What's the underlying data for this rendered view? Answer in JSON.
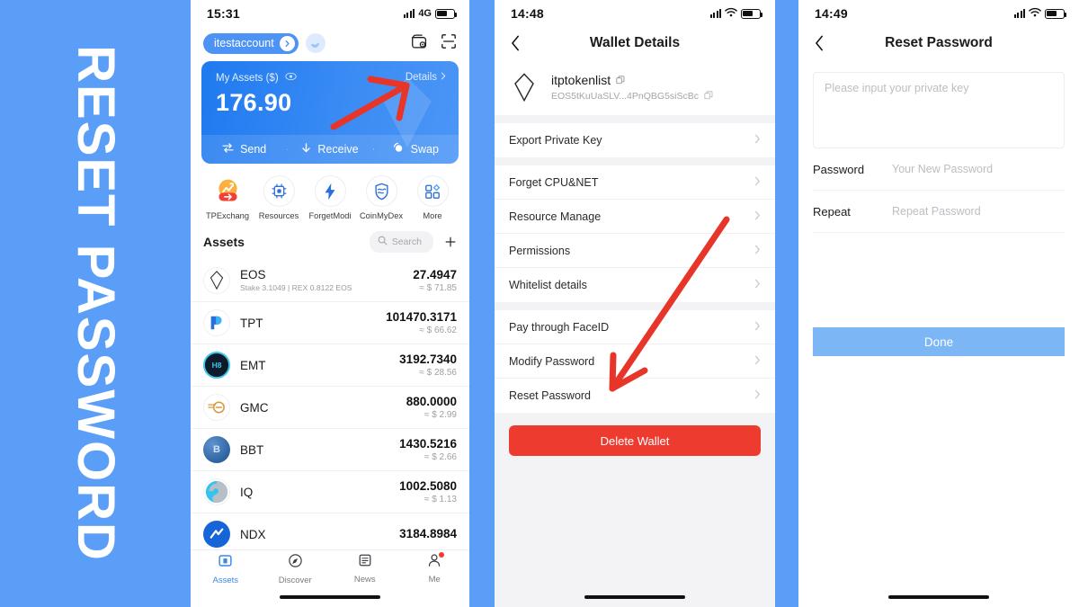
{
  "caption": {
    "text": "RESET PASSWORD"
  },
  "theme": {
    "background": "#5b9ef7",
    "accent": "#3b86f0",
    "danger": "#ee3b2f",
    "done_button": "#7db6f5"
  },
  "phone1": {
    "status": {
      "time": "15:31",
      "network": "4G"
    },
    "header": {
      "account": "itestaccount",
      "wallet_icon": "wallet-scan-icon",
      "scan_icon": "qr-scan-icon"
    },
    "assets_card": {
      "label": "My Assets  ($)",
      "details": "Details",
      "balance": "176.90",
      "actions": [
        {
          "label": "Send",
          "icon": "send-icon"
        },
        {
          "label": "Receive",
          "icon": "receive-icon"
        },
        {
          "label": "Swap",
          "icon": "swap-icon"
        }
      ]
    },
    "quick_actions": [
      {
        "label": "TPExchang",
        "icon": "tpexchange-icon"
      },
      {
        "label": "Resources",
        "icon": "cpu-icon"
      },
      {
        "label": "ForgetModi",
        "icon": "bolt-icon"
      },
      {
        "label": "CoinMyDex",
        "icon": "shield-icon"
      },
      {
        "label": "More",
        "icon": "grid-icon"
      }
    ],
    "assets_section": {
      "title": "Assets",
      "search_placeholder": "Search",
      "add_label": "+"
    },
    "assets": [
      {
        "symbol": "EOS",
        "sub": "Stake 3.1049  |  REX 0.8122 EOS",
        "amount": "27.4947",
        "usd": "≈ $ 71.85"
      },
      {
        "symbol": "TPT",
        "sub": "",
        "amount": "101470.3171",
        "usd": "≈ $ 66.62"
      },
      {
        "symbol": "EMT",
        "sub": "",
        "amount": "3192.7340",
        "usd": "≈ $ 28.56"
      },
      {
        "symbol": "GMC",
        "sub": "",
        "amount": "880.0000",
        "usd": "≈ $ 2.99"
      },
      {
        "symbol": "BBT",
        "sub": "",
        "amount": "1430.5216",
        "usd": "≈ $ 2.66"
      },
      {
        "symbol": "IQ",
        "sub": "",
        "amount": "1002.5080",
        "usd": "≈ $ 1.13"
      },
      {
        "symbol": "NDX",
        "sub": "",
        "amount": "3184.8984",
        "usd": ""
      }
    ],
    "tabbar": [
      {
        "label": "Assets",
        "icon": "wallet-icon",
        "active": true
      },
      {
        "label": "Discover",
        "icon": "compass-icon",
        "active": false
      },
      {
        "label": "News",
        "icon": "news-icon",
        "active": false
      },
      {
        "label": "Me",
        "icon": "person-icon",
        "active": false
      }
    ]
  },
  "phone2": {
    "status": {
      "time": "14:48",
      "network": "wifi"
    },
    "nav": {
      "title": "Wallet Details",
      "back": "back-icon"
    },
    "wallet": {
      "name": "itptokenlist",
      "address": "EOS5tKuUaSLV...4PnQBG5siScBc",
      "logo": "eos-logo-icon"
    },
    "menu_group_1": [
      {
        "label": "Export Private Key"
      }
    ],
    "menu_group_2": [
      {
        "label": "Forget CPU&NET"
      },
      {
        "label": "Resource Manage"
      },
      {
        "label": "Permissions"
      },
      {
        "label": "Whitelist details"
      }
    ],
    "menu_group_3": [
      {
        "label": "Pay through FaceID"
      },
      {
        "label": "Modify Password"
      },
      {
        "label": "Reset Password"
      }
    ],
    "delete_button": "Delete Wallet"
  },
  "phone3": {
    "status": {
      "time": "14:49",
      "network": "wifi"
    },
    "nav": {
      "title": "Reset Password",
      "back": "back-icon"
    },
    "private_key_placeholder": "Please input your private key",
    "fields": [
      {
        "label": "Password",
        "placeholder": "Your New Password",
        "value": ""
      },
      {
        "label": "Repeat",
        "placeholder": "Repeat Password",
        "value": ""
      }
    ],
    "done_button": "Done"
  }
}
